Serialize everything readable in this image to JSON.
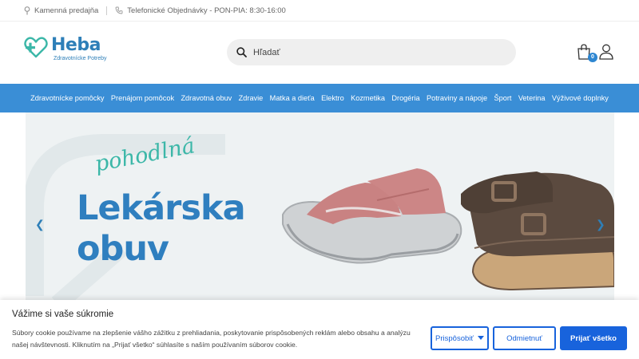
{
  "topbar": {
    "store_label": "Kamenná predajňa",
    "phone_label": "Telefonické Objednávky - PON-PIA: 8:30-16:00"
  },
  "logo": {
    "name": "Heba",
    "tagline": "Zdravotnícke Potreby"
  },
  "search": {
    "placeholder": "Hľadať"
  },
  "cart": {
    "count": "0"
  },
  "nav": {
    "items": [
      "Zdravotnícke pomôcky",
      "Prenájom pomôcok",
      "Zdravotná obuv",
      "Zdravie",
      "Matka a dieťa",
      "Elektro",
      "Kozmetika",
      "Drogéria",
      "Potraviny a nápoje",
      "Šport",
      "Veterina",
      "Výživové doplnky"
    ]
  },
  "hero": {
    "script_text": "pohodlná",
    "title_line1": "Lekárska",
    "title_line2": "obuv",
    "prev_arrow": "❮",
    "next_arrow": "❯"
  },
  "cookie": {
    "title": "Vážime si vaše súkromie",
    "text": "Súbory cookie používame na zlepšenie vášho zážitku z prehliadania, poskytovanie prispôsobených reklám alebo obsahu a analýzu našej návštevnosti. Kliknutím na „Prijať všetko“ súhlasíte s naším používaním súborov cookie.",
    "customize_label": "Prispôsobiť",
    "reject_label": "Odmietnuť",
    "accept_label": "Prijať všetko"
  },
  "colors": {
    "brand_blue": "#2e7fb8",
    "nav_blue": "#3a8ed6",
    "button_blue": "#1863dc",
    "accent_teal": "#3cb7a8"
  }
}
